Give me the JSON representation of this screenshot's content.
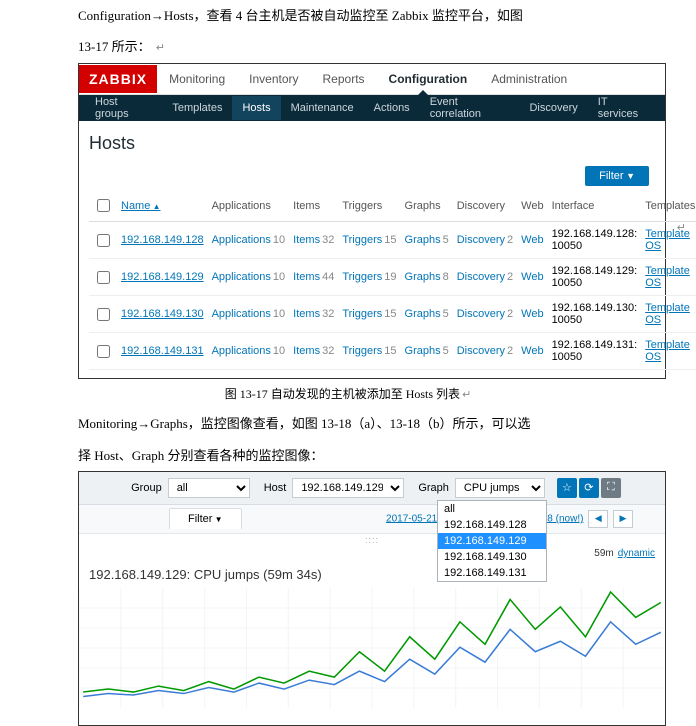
{
  "doc": {
    "line1": "Configuration→Hosts，查看 4 台主机是否被自动监控至 Zabbix 监控平台，如图",
    "line2": "13-17 所示：",
    "caption1": "图 13-17  自动发现的主机被添加至 Hosts 列表",
    "line3": "Monitoring→Graphs，监控图像查看，如图 13-18（a）、13-18（b）所示，可以选",
    "line4": "择 Host、Graph 分别查看各种的监控图像：",
    "return": "↵"
  },
  "zabbix": {
    "logo": "ZABBIX",
    "topnav": [
      "Monitoring",
      "Inventory",
      "Reports",
      "Configuration",
      "Administration"
    ],
    "topnav_active": "Configuration",
    "subnav": [
      "Host groups",
      "Templates",
      "Hosts",
      "Maintenance",
      "Actions",
      "Event correlation",
      "Discovery",
      "IT services"
    ],
    "subnav_active": "Hosts",
    "page_title": "Hosts",
    "filter_label": "Filter",
    "columns": {
      "name": "Name",
      "apps": "Applications",
      "items": "Items",
      "triggers": "Triggers",
      "graphs": "Graphs",
      "discovery": "Discovery",
      "web": "Web",
      "interface": "Interface",
      "templates": "Templates"
    },
    "rows": [
      {
        "name": "192.168.149.128",
        "apps": "10",
        "items": "32",
        "triggers": "15",
        "graphs": "5",
        "discovery": "2",
        "web": "",
        "interface": "192.168.149.128: 10050",
        "templ": "Template OS"
      },
      {
        "name": "192.168.149.129",
        "apps": "10",
        "items": "44",
        "triggers": "19",
        "graphs": "8",
        "discovery": "2",
        "web": "",
        "interface": "192.168.149.129: 10050",
        "templ": "Template OS"
      },
      {
        "name": "192.168.149.130",
        "apps": "10",
        "items": "32",
        "triggers": "15",
        "graphs": "5",
        "discovery": "2",
        "web": "",
        "interface": "192.168.149.130: 10050",
        "templ": "Template OS"
      },
      {
        "name": "192.168.149.131",
        "apps": "10",
        "items": "32",
        "triggers": "15",
        "graphs": "5",
        "discovery": "2",
        "web": "",
        "interface": "192.168.149.131: 10050",
        "templ": "Template OS"
      }
    ],
    "apps_label": "Applications",
    "items_label": "Items",
    "triggers_label": "Triggers",
    "graphs_label": "Graphs",
    "discovery_label": "Discovery",
    "web_label": "Web"
  },
  "graphs": {
    "group_label": "Group",
    "group_value": "all",
    "host_label": "Host",
    "host_value": "192.168.149.129",
    "graph_label": "Graph",
    "graph_value": "CPU jumps",
    "dropdown": [
      "all",
      "192.168.149.128",
      "192.168.149.129",
      "192.168.149.130",
      "192.168.149.131"
    ],
    "dropdown_selected": "192.168.149.129",
    "filter_tab": "Filter",
    "time_from": "2017-05-21 09:18",
    "time_to": "2017-05-21 10:18 (now!)",
    "nav_prev": "◀",
    "nav_next": "▶",
    "duration": "59m",
    "dynamic": "dynamic",
    "chart_title": "192.168.149.129: CPU jumps (59m 34s)",
    "handle": "::::"
  },
  "chart_data": {
    "type": "line",
    "title": "192.168.149.129: CPU jumps (59m 34s)",
    "xlabel": "",
    "ylabel": "",
    "x_range_minutes": 59,
    "series": [
      {
        "name": "series-green",
        "color": "#009900",
        "values": [
          8,
          10,
          8,
          12,
          9,
          15,
          10,
          18,
          14,
          22,
          18,
          35,
          22,
          45,
          30,
          55,
          40,
          70,
          50,
          65,
          45,
          75,
          58,
          68
        ]
      },
      {
        "name": "series-blue",
        "color": "#3a7cd6",
        "values": [
          5,
          7,
          6,
          9,
          7,
          11,
          8,
          14,
          10,
          16,
          13,
          22,
          15,
          30,
          20,
          38,
          28,
          50,
          35,
          42,
          32,
          55,
          40,
          48
        ]
      }
    ]
  }
}
